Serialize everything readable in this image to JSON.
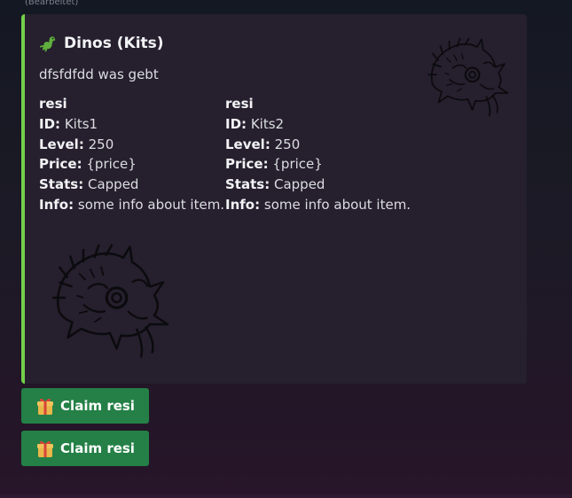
{
  "message": {
    "edited_label": "(Bearbeitet)"
  },
  "embed": {
    "accent_color": "#74d04a",
    "title_icon": "dinosaur-icon",
    "title": "Dinos (Kits)",
    "description": "dfsfdfdd was gebt",
    "thumbnail_icon": "dragon-head-sketch",
    "image_icon": "dragon-head-sketch",
    "fields": [
      {
        "name": "resi",
        "id_label": "ID:",
        "id_value": "Kits1",
        "level_label": "Level:",
        "level_value": "250",
        "price_label": "Price:",
        "price_value": "{price}",
        "stats_label": "Stats:",
        "stats_value": "Capped",
        "info_label": "Info:",
        "info_value": "some info about item."
      },
      {
        "name": "resi",
        "id_label": "ID:",
        "id_value": "Kits2",
        "level_label": "Level:",
        "level_value": "250",
        "price_label": "Price:",
        "price_value": "{price}",
        "stats_label": "Stats:",
        "stats_value": "Capped",
        "info_label": "Info:",
        "info_value": "some info about item."
      }
    ]
  },
  "buttons": [
    {
      "icon": "gift-icon",
      "label": "Claim resi",
      "color": "#248046"
    },
    {
      "icon": "gift-icon",
      "label": "Claim resi",
      "color": "#248046"
    }
  ]
}
